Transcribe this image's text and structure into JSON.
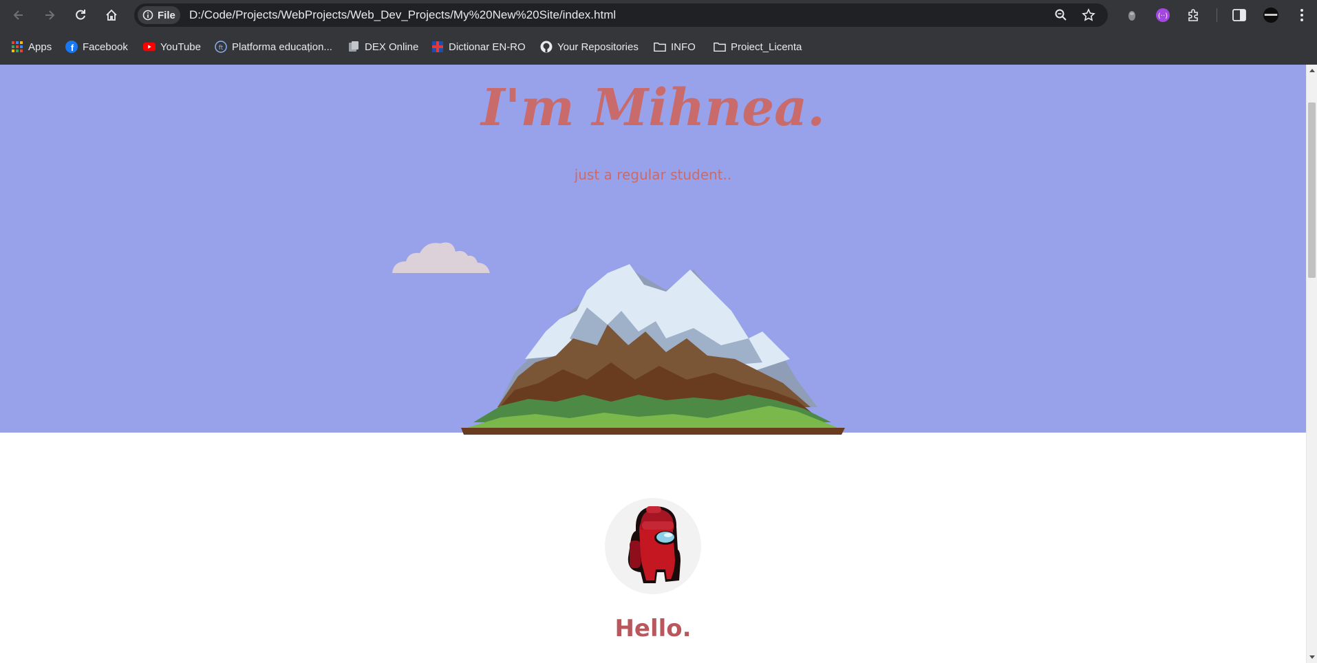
{
  "browser": {
    "site_info_label": "File",
    "url": "D:/Code/Projects/WebProjects/Web_Dev_Projects/My%20New%20Site/index.html",
    "bookmarks": [
      {
        "label": "Apps",
        "icon": "apps-grid-icon"
      },
      {
        "label": "Facebook",
        "icon": "facebook-icon"
      },
      {
        "label": "YouTube",
        "icon": "youtube-icon"
      },
      {
        "label": "Platforma educațion...",
        "icon": "platform-icon"
      },
      {
        "label": "DEX Online",
        "icon": "dex-icon"
      },
      {
        "label": "Dictionar EN-RO",
        "icon": "dictionary-icon"
      },
      {
        "label": "Your Repositories",
        "icon": "github-icon"
      },
      {
        "label": "INFO",
        "icon": "folder-icon"
      },
      {
        "label": "Proiect_Licenta",
        "icon": "folder-icon"
      }
    ]
  },
  "hero": {
    "title": "I'm Mihnea.",
    "subtitle": "just a regular student.."
  },
  "about": {
    "heading": "Hello."
  },
  "colors": {
    "hero_background": "#98a2ea",
    "accent_text": "#c96b6b",
    "chrome_background": "#35363a"
  }
}
